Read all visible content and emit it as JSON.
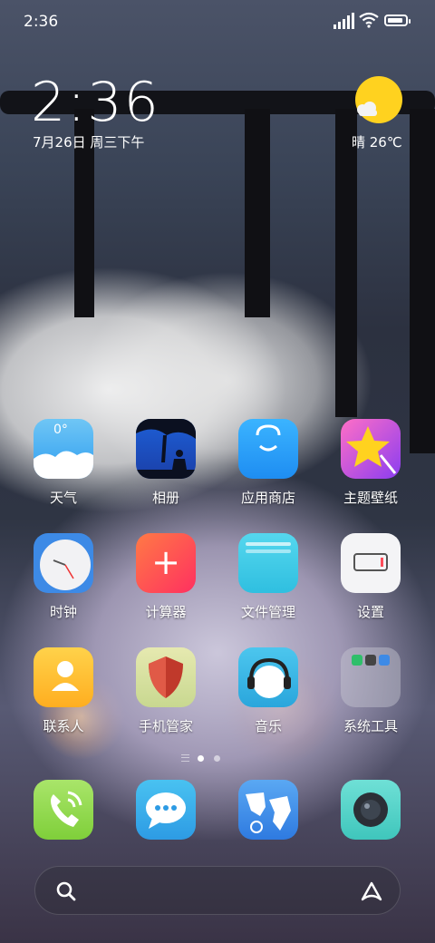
{
  "status_bar": {
    "time": "2:36",
    "battery_level": 0.8
  },
  "lockclock": {
    "time": "2:36",
    "date": "7月26日 周三下午",
    "weather": "晴 26℃"
  },
  "apps": [
    {
      "label": "天气",
      "icon": "weather-icon"
    },
    {
      "label": "相册",
      "icon": "gallery-icon"
    },
    {
      "label": "应用商店",
      "icon": "app-store-icon"
    },
    {
      "label": "主题壁纸",
      "icon": "themes-icon"
    },
    {
      "label": "时钟",
      "icon": "clock-icon"
    },
    {
      "label": "计算器",
      "icon": "calculator-icon"
    },
    {
      "label": "文件管理",
      "icon": "file-manager-icon"
    },
    {
      "label": "设置",
      "icon": "settings-icon"
    },
    {
      "label": "联系人",
      "icon": "contacts-icon"
    },
    {
      "label": "手机管家",
      "icon": "security-icon"
    },
    {
      "label": "音乐",
      "icon": "music-icon"
    },
    {
      "label": "系统工具",
      "icon": "system-tools-folder-icon"
    }
  ],
  "dock": [
    {
      "name": "phone",
      "icon": "phone-icon"
    },
    {
      "name": "messages",
      "icon": "messages-icon"
    },
    {
      "name": "browser",
      "icon": "browser-icon"
    },
    {
      "name": "camera",
      "icon": "camera-icon"
    }
  ],
  "page_indicator": {
    "current": 1,
    "pages": 2
  },
  "colors": {
    "sun": "#ffd21f",
    "accent_red": "#ff4d5a"
  }
}
